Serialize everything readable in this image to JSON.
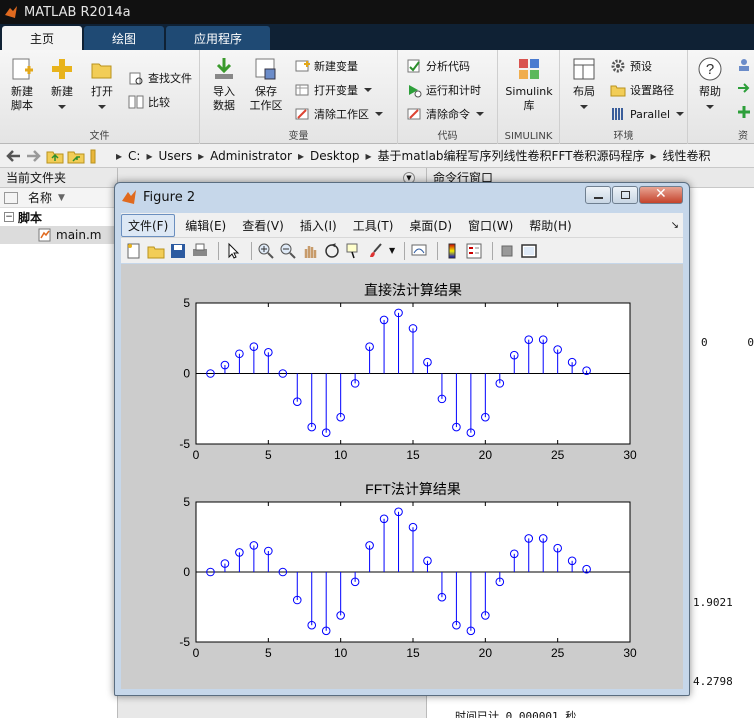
{
  "app": {
    "title": "MATLAB R2014a"
  },
  "tabs": [
    {
      "label": "主页"
    },
    {
      "label": "绘图"
    },
    {
      "label": "应用程序"
    }
  ],
  "ribbon": {
    "file_group": {
      "label": "文件",
      "new_script": "新建\n脚本",
      "new": "新建",
      "open": "打开",
      "find_files": "查找文件",
      "compare": "比较"
    },
    "variable_group": {
      "label": "变量",
      "import_data": "导入\n数据",
      "save_workspace": "保存\n工作区",
      "new_variable": "新建变量",
      "open_variable": "打开变量",
      "clear_workspace": "清除工作区"
    },
    "code_group": {
      "label": "代码",
      "analyze_code": "分析代码",
      "run_and_time": "运行和计时",
      "clear_commands": "清除命令"
    },
    "simulink_group": {
      "label": "SIMULINK",
      "simulink_library": "Simulink\n库"
    },
    "env_group": {
      "label": "环境",
      "layout": "布局",
      "preferences": "预设",
      "set_path": "设置路径",
      "parallel": "Parallel"
    },
    "help_label": "帮助",
    "community_label": "资"
  },
  "address": {
    "crumbs": [
      "C:",
      "Users",
      "Administrator",
      "Desktop",
      "基于matlab编程写序列线性卷积FFT卷积源码程序",
      "线性卷积"
    ]
  },
  "left_panel": {
    "title": "当前文件夹",
    "column": "名称",
    "folder": "脚本",
    "file": "main.m"
  },
  "command_window": {
    "title": "命令行窗口",
    "line1": "0      0",
    "line2": "1.9021",
    "line3": "4.2798",
    "line4": "时间已计 0.000001 秒"
  },
  "figure": {
    "title": "Figure 2",
    "menus": [
      "文件(F)",
      "编辑(E)",
      "查看(V)",
      "插入(I)",
      "工具(T)",
      "桌面(D)",
      "窗口(W)",
      "帮助(H)"
    ]
  },
  "chart_data": [
    {
      "type": "stem",
      "title": "直接法计算结果",
      "x": [
        1,
        2,
        3,
        4,
        5,
        6,
        7,
        8,
        9,
        10,
        11,
        12,
        13,
        14,
        15,
        16,
        17,
        18,
        19,
        20,
        21,
        22,
        23,
        24,
        25,
        26,
        27
      ],
      "values": [
        0,
        0.6,
        1.4,
        1.9,
        1.5,
        0.0,
        -2.0,
        -3.8,
        -4.2,
        -3.1,
        -0.7,
        1.9,
        3.8,
        4.3,
        3.2,
        0.8,
        -1.8,
        -3.8,
        -4.2,
        -3.1,
        -0.7,
        1.3,
        2.4,
        2.4,
        1.7,
        0.8,
        0.2
      ],
      "xlim": [
        0,
        30
      ],
      "ylim": [
        -5,
        5
      ],
      "xticks": [
        0,
        5,
        10,
        15,
        20,
        25,
        30
      ],
      "yticks": [
        -5,
        0,
        5
      ],
      "color": "#0000ff"
    },
    {
      "type": "stem",
      "title": "FFT法计算结果",
      "x": [
        1,
        2,
        3,
        4,
        5,
        6,
        7,
        8,
        9,
        10,
        11,
        12,
        13,
        14,
        15,
        16,
        17,
        18,
        19,
        20,
        21,
        22,
        23,
        24,
        25,
        26,
        27
      ],
      "values": [
        0,
        0.6,
        1.4,
        1.9,
        1.5,
        0.0,
        -2.0,
        -3.8,
        -4.2,
        -3.1,
        -0.7,
        1.9,
        3.8,
        4.3,
        3.2,
        0.8,
        -1.8,
        -3.8,
        -4.2,
        -3.1,
        -0.7,
        1.3,
        2.4,
        2.4,
        1.7,
        0.8,
        0.2
      ],
      "xlim": [
        0,
        30
      ],
      "ylim": [
        -5,
        5
      ],
      "xticks": [
        0,
        5,
        10,
        15,
        20,
        25,
        30
      ],
      "yticks": [
        -5,
        0,
        5
      ],
      "color": "#0000ff"
    }
  ]
}
